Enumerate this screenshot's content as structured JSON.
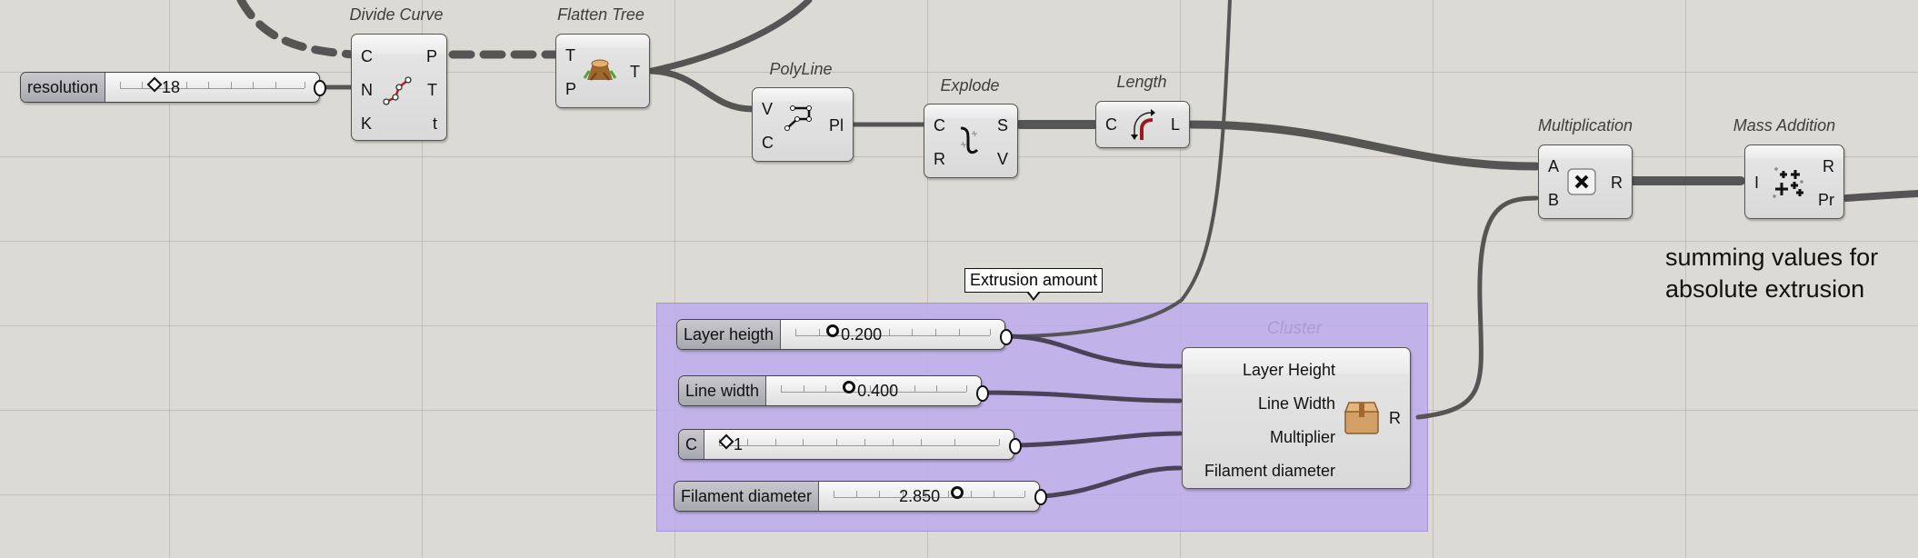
{
  "canvas": {
    "background": "#dcdad4",
    "group_color": "#bcaaec"
  },
  "components": {
    "divide_curve": {
      "title": "Divide Curve",
      "inputs": [
        "C",
        "N",
        "K"
      ],
      "outputs": [
        "P",
        "T",
        "t"
      ],
      "icon": "divide-curve-icon"
    },
    "flatten_tree": {
      "title": "Flatten Tree",
      "inputs": [
        "T",
        "P"
      ],
      "outputs": [
        "T"
      ],
      "icon": "tree-stump-icon"
    },
    "polyline": {
      "title": "PolyLine",
      "inputs": [
        "V",
        "C"
      ],
      "outputs": [
        "Pl"
      ],
      "icon": "polyline-icon"
    },
    "explode": {
      "title": "Explode",
      "inputs": [
        "C",
        "R"
      ],
      "outputs": [
        "S",
        "V"
      ],
      "icon": "explode-icon"
    },
    "length": {
      "title": "Length",
      "inputs": [
        "C"
      ],
      "outputs": [
        "L"
      ],
      "icon": "curve-length-icon"
    },
    "multiplication": {
      "title": "Multiplication",
      "inputs": [
        "A",
        "B"
      ],
      "outputs": [
        "R"
      ],
      "icon": "multiply-icon"
    },
    "mass_addition": {
      "title": "Mass Addition",
      "inputs": [
        "I"
      ],
      "outputs": [
        "R",
        "Pr"
      ],
      "icon": "mass-addition-icon"
    },
    "cluster": {
      "title": "Cluster",
      "inputs": [
        "Layer Height",
        "Line Width",
        "Multiplier",
        "Filament diameter"
      ],
      "outputs": [
        "R"
      ],
      "icon": "cluster-box-icon"
    }
  },
  "sliders": {
    "resolution": {
      "label": "resolution",
      "value": "18",
      "type": "integer"
    },
    "layer_height": {
      "label": "Layer heigth",
      "value": "0.200",
      "type": "float"
    },
    "line_width": {
      "label": "Line width",
      "value": "0.400",
      "type": "float"
    },
    "multiplier": {
      "label": "C",
      "value": "1",
      "type": "integer"
    },
    "filament": {
      "label": "Filament diameter",
      "value": "2.850",
      "type": "float"
    }
  },
  "tooltip": {
    "text": "Extrusion amount"
  },
  "note": {
    "line1": "summing values for",
    "line2": "absolute extrusion"
  }
}
